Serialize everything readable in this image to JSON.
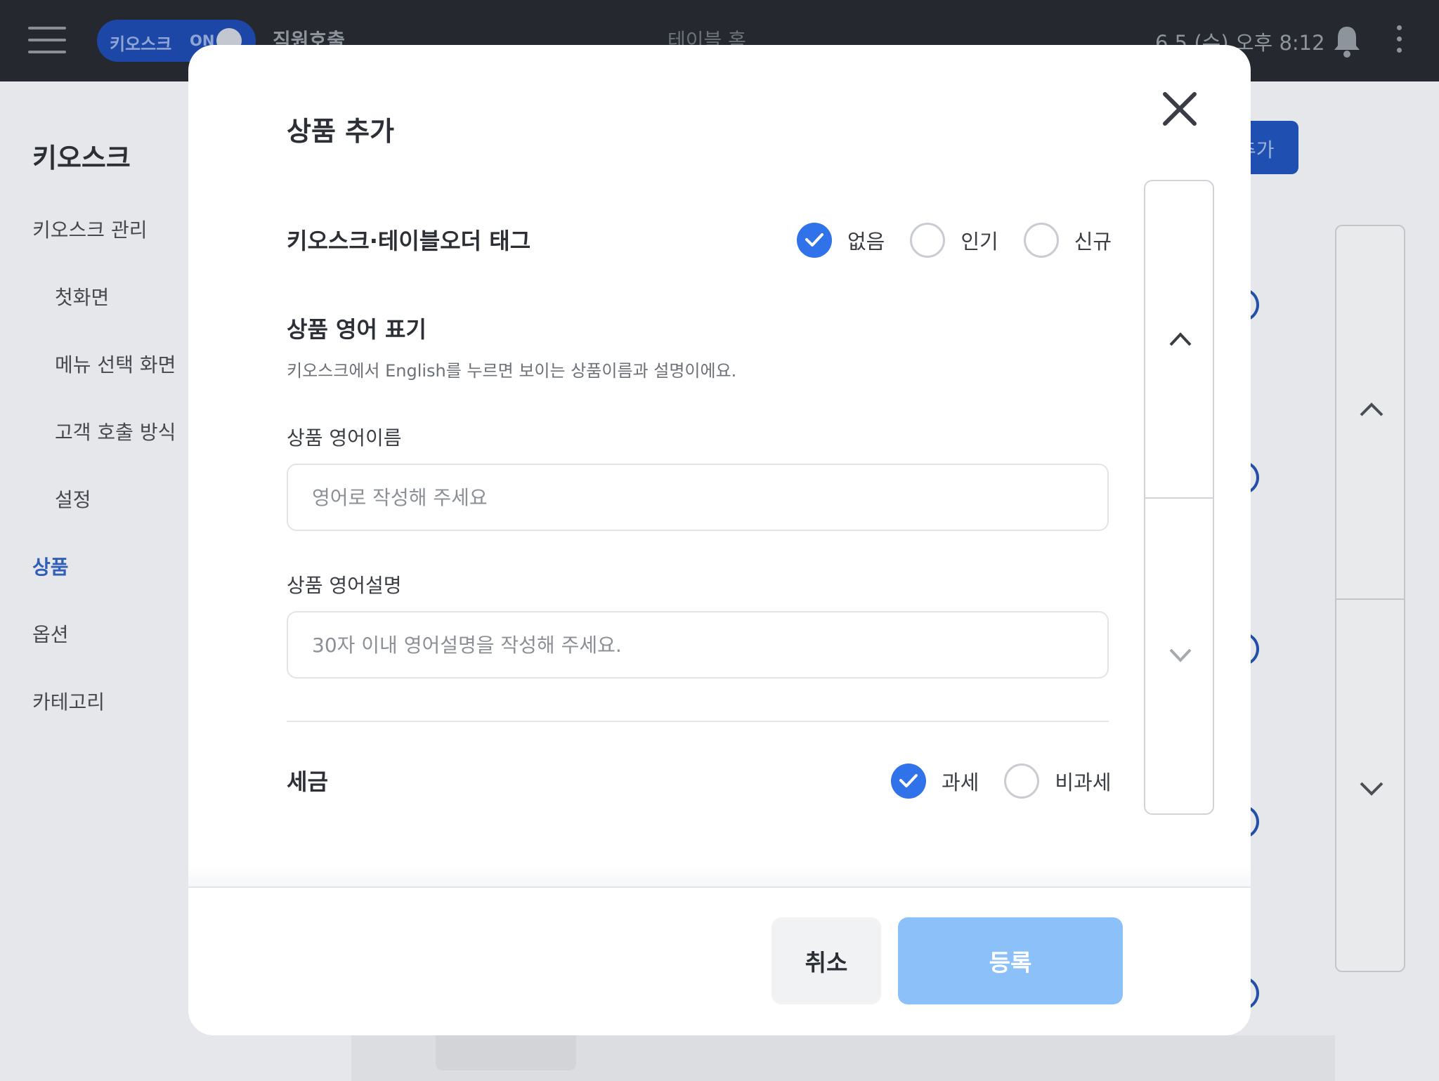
{
  "topbar": {
    "kiosk_label": "키오스크",
    "kiosk_toggle": "ON",
    "staff_call": "직원호출",
    "table_title": "테이블 홈",
    "datetime": "6.5 (수) 오후 8:12"
  },
  "sidebar": {
    "title": "키오스크",
    "items": [
      {
        "label": "키오스크 관리"
      },
      {
        "label": "첫화면"
      },
      {
        "label": "메뉴 선택 화면"
      },
      {
        "label": "고객 호출 방식"
      },
      {
        "label": "설정"
      },
      {
        "label": "상품"
      },
      {
        "label": "옵션"
      },
      {
        "label": "카테고리"
      }
    ]
  },
  "background": {
    "add_button_label": "추가"
  },
  "modal": {
    "title": "상품 추가",
    "tag_section": {
      "label": "키오스크·테이블오더 태그",
      "options": [
        {
          "label": "없음",
          "checked": true
        },
        {
          "label": "인기",
          "checked": false
        },
        {
          "label": "신규",
          "checked": false
        }
      ]
    },
    "english_section": {
      "title": "상품 영어 표기",
      "hint": "키오스크에서 English를 누르면 보이는 상품이름과 설명이에요.",
      "name_label": "상품 영어이름",
      "name_placeholder": "영어로 작성해 주세요",
      "name_value": "",
      "desc_label": "상품 영어설명",
      "desc_placeholder": "30자 이내 영어설명을 작성해 주세요.",
      "desc_value": ""
    },
    "tax_section": {
      "label": "세금",
      "options": [
        {
          "label": "과세",
          "checked": true
        },
        {
          "label": "비과세",
          "checked": false
        }
      ]
    },
    "footer": {
      "cancel_label": "취소",
      "submit_label": "등록"
    }
  },
  "colors": {
    "accent": "#2f72ea",
    "submit_disabled": "#8cc0f8",
    "topbar": "#25292f",
    "sidebar_active": "#2f5fb8"
  },
  "icons": {
    "menu": "hamburger-icon",
    "notifications": "bell-icon",
    "more": "more-vertical-icon",
    "close": "close-icon",
    "scroll_up": "chevron-up-icon",
    "scroll_down": "chevron-down-icon",
    "check": "check-icon"
  }
}
